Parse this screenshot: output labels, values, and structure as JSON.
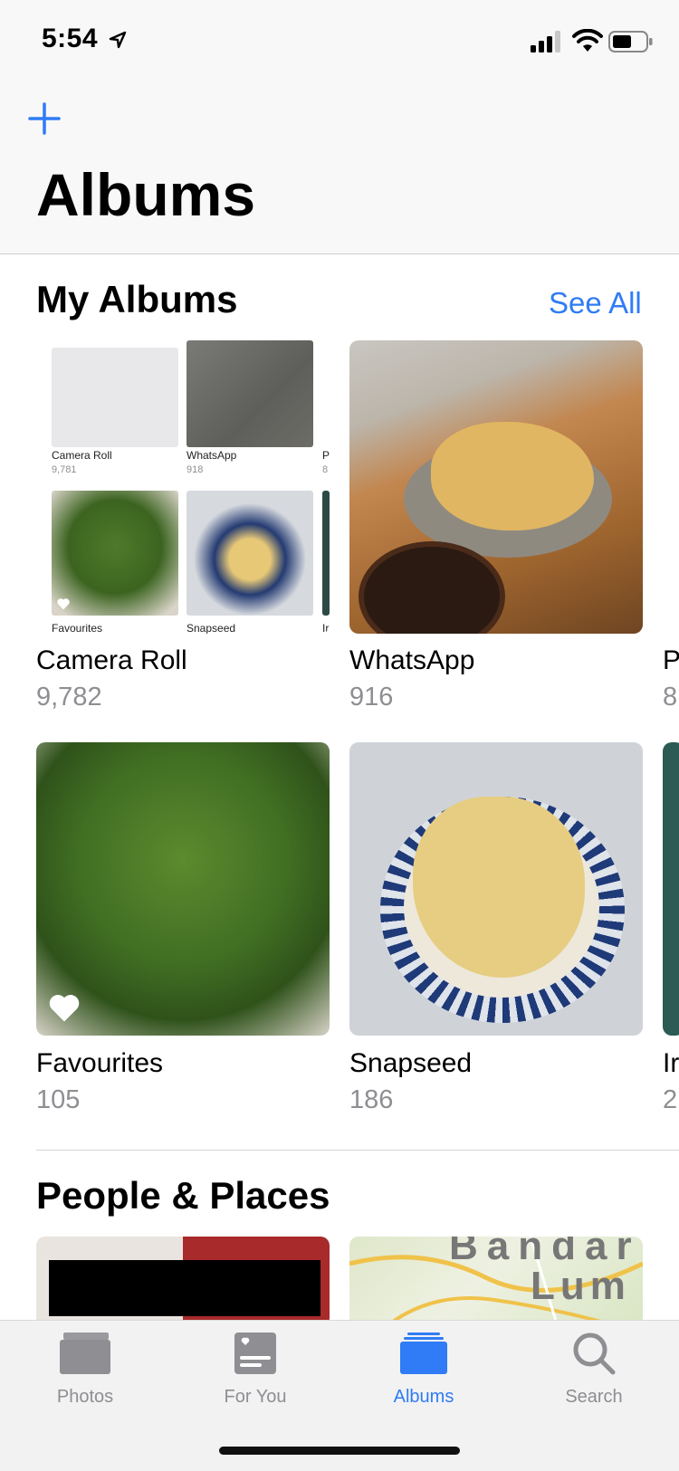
{
  "status_bar": {
    "time": "5:54"
  },
  "header": {
    "title": "Albums"
  },
  "my_albums": {
    "title": "My Albums",
    "see_all": "See All",
    "preview_labels": [
      {
        "name": "Camera Roll",
        "count": "9,781"
      },
      {
        "name": "WhatsApp",
        "count": "918"
      },
      {
        "name": "P",
        "count": "8"
      },
      {
        "name": "Favourites"
      },
      {
        "name": "Snapseed"
      },
      {
        "name": "Ir"
      }
    ],
    "albums": [
      {
        "name": "Camera Roll",
        "count": "9,782"
      },
      {
        "name": "WhatsApp",
        "count": "916"
      },
      {
        "name": "P",
        "count": "8"
      },
      {
        "name": "Favourites",
        "count": "105"
      },
      {
        "name": "Snapseed",
        "count": "186"
      },
      {
        "name": "Ir",
        "count": "2"
      }
    ]
  },
  "people_places": {
    "title": "People & Places",
    "map_text_1": "Bandar",
    "map_text_2": "Lum"
  },
  "tab_bar": {
    "tabs": [
      {
        "label": "Photos",
        "icon": "photos-icon"
      },
      {
        "label": "For You",
        "icon": "for-you-icon"
      },
      {
        "label": "Albums",
        "icon": "albums-icon",
        "selected": true
      },
      {
        "label": "Search",
        "icon": "search-icon"
      }
    ]
  },
  "colors": {
    "accent": "#2f7cf6",
    "secondary_text": "#8e8e93"
  }
}
